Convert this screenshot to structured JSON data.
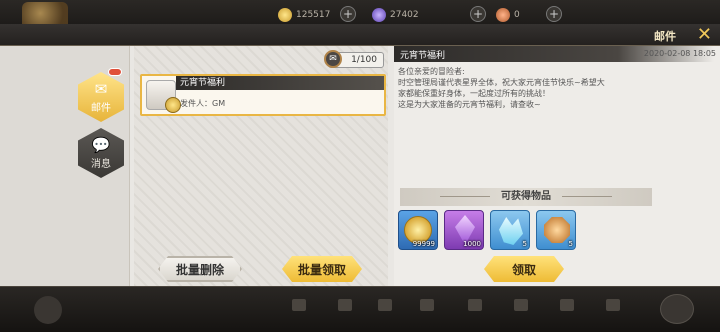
{
  "topbar": {
    "gold_value": "125517",
    "gem_value": "27402",
    "ticket_value": "0"
  },
  "window": {
    "title": "邮件",
    "close_glyph": "✕"
  },
  "sidebar": {
    "tabs": [
      {
        "label": "邮件",
        "icon": "mail-icon",
        "active": true
      },
      {
        "label": "消息",
        "icon": "chat-icon",
        "active": false
      }
    ]
  },
  "mail_list": {
    "counter": "1/100",
    "items": [
      {
        "title": "元宵节福利",
        "sender": "发件人：GM"
      }
    ]
  },
  "detail": {
    "title": "元宵节福利",
    "date": "2020-02-08 18:05",
    "body": [
      "各位亲爱的冒险者:",
      "时空管理局谨代表星界全体，祝大家元宵佳节快乐~希望大",
      "家都能保重好身体，一起度过所有的挑战！",
      "这是为大家准备的元宵节福利，请查收~"
    ],
    "rewards_heading": "可获得物品",
    "rewards": [
      {
        "icon": "gold-coin-icon",
        "qty": "99999"
      },
      {
        "icon": "purple-gem-icon",
        "qty": "1000"
      },
      {
        "icon": "blue-crystal-icon",
        "qty": "5"
      },
      {
        "icon": "amber-stone-icon",
        "qty": "5"
      }
    ]
  },
  "buttons": {
    "batch_delete": "批量删除",
    "batch_claim": "批量领取",
    "claim": "领取"
  },
  "colors": {
    "accent_gold": "#eebb35",
    "header_dark": "#2d2b29",
    "panel_bg": "#e9e7e3"
  }
}
